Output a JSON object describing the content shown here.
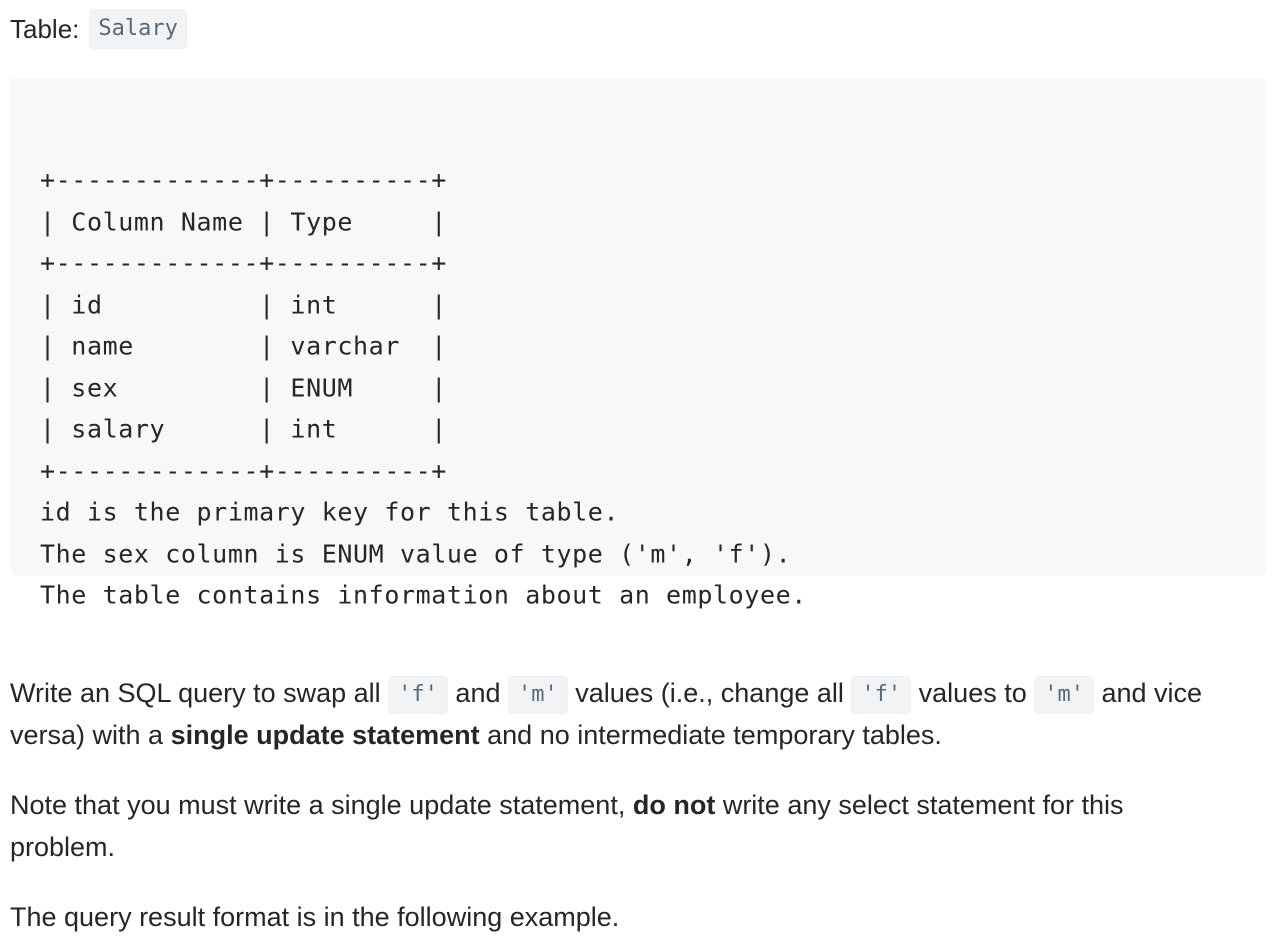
{
  "table_label": {
    "prefix": "Table:",
    "name": "Salary"
  },
  "schema_block": {
    "lines": [
      "+-------------+----------+",
      "| Column Name | Type     |",
      "+-------------+----------+",
      "| id          | int      |",
      "| name        | varchar  |",
      "| sex         | ENUM     |",
      "| salary      | int      |",
      "+-------------+----------+",
      "id is the primary key for this table.",
      "The sex column is ENUM value of type ('m', 'f').",
      "The table contains information about an employee."
    ]
  },
  "paragraph1": {
    "part1": "Write an SQL query to swap all ",
    "code1": "'f'",
    "part2": " and ",
    "code2": "'m'",
    "part3": " values (i.e., change all ",
    "code3": "'f'",
    "part4": " values to ",
    "code4": "'m'",
    "part5": " and vice versa) with a ",
    "bold": "single update statement",
    "part6": " and no intermediate temporary tables."
  },
  "paragraph2": {
    "part1": "Note that you must write a single update statement, ",
    "bold": "do not",
    "part2": " write any select statement for this problem."
  },
  "paragraph3": {
    "text": "The query result format is in the following example."
  }
}
